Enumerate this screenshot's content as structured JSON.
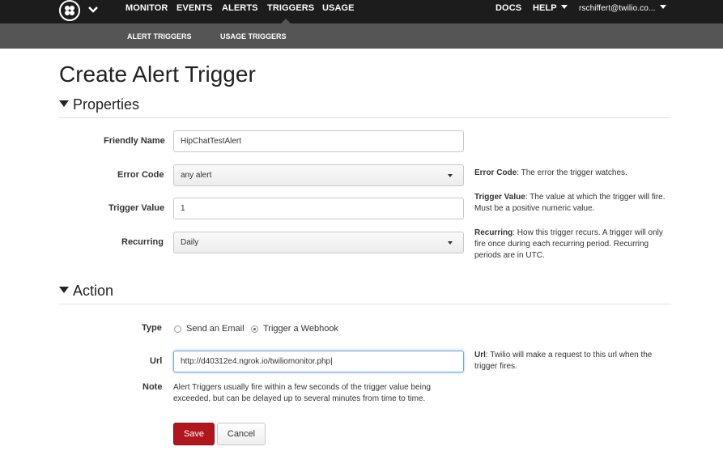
{
  "topnav": {
    "items": [
      {
        "label": "MONITOR"
      },
      {
        "label": "EVENTS"
      },
      {
        "label": "ALERTS"
      },
      {
        "label": "TRIGGERS"
      },
      {
        "label": "USAGE"
      }
    ],
    "right": {
      "docs": "DOCS",
      "help": "HELP",
      "user": "rschiffert@twilio.co..."
    }
  },
  "subnav": {
    "items": [
      {
        "label": "ALERT TRIGGERS"
      },
      {
        "label": "USAGE TRIGGERS"
      }
    ]
  },
  "page": {
    "title": "Create Alert Trigger"
  },
  "properties": {
    "heading": "Properties",
    "friendly_name": {
      "label": "Friendly Name",
      "value": "HipChatTestAlert"
    },
    "error_code": {
      "label": "Error Code",
      "value": "any alert",
      "help_title": "Error Code",
      "help_text": ": The error the trigger watches."
    },
    "trigger_value": {
      "label": "Trigger Value",
      "value": "1",
      "help_title": "Trigger Value",
      "help_text": ": The value at which the trigger will fire. Must be a positive numeric value."
    },
    "recurring": {
      "label": "Recurring",
      "value": "Daily",
      "help_title": "Recurring",
      "help_text": ": How this trigger recurs. A trigger will only fire once during each recurring period. Recurring periods are in UTC."
    }
  },
  "action": {
    "heading": "Action",
    "type": {
      "label": "Type",
      "options": [
        {
          "label": "Send an Email",
          "selected": false
        },
        {
          "label": "Trigger a Webhook",
          "selected": true
        }
      ]
    },
    "url": {
      "label": "Url",
      "value": "http://d40312e4.ngrok.io/twiliomonitor.php|",
      "help_title": "Url",
      "help_text": ": Twilio will make a request to this url when the trigger fires."
    },
    "note": {
      "label": "Note",
      "text": "Alert Triggers usually fire within a few seconds of the trigger value being exceeded, but can be delayed up to several minutes from time to time."
    }
  },
  "buttons": {
    "save": "Save",
    "cancel": "Cancel"
  },
  "colors": {
    "topnav_bg": "#1c1c1c",
    "subnav_bg": "#555555",
    "save_button": "#b0161b"
  },
  "icons": {
    "logo": "twilio-logo-icon",
    "menu_chevron": "chevron-down-icon",
    "dropdown": "caret-down-icon",
    "section_toggle": "triangle-down-icon"
  }
}
